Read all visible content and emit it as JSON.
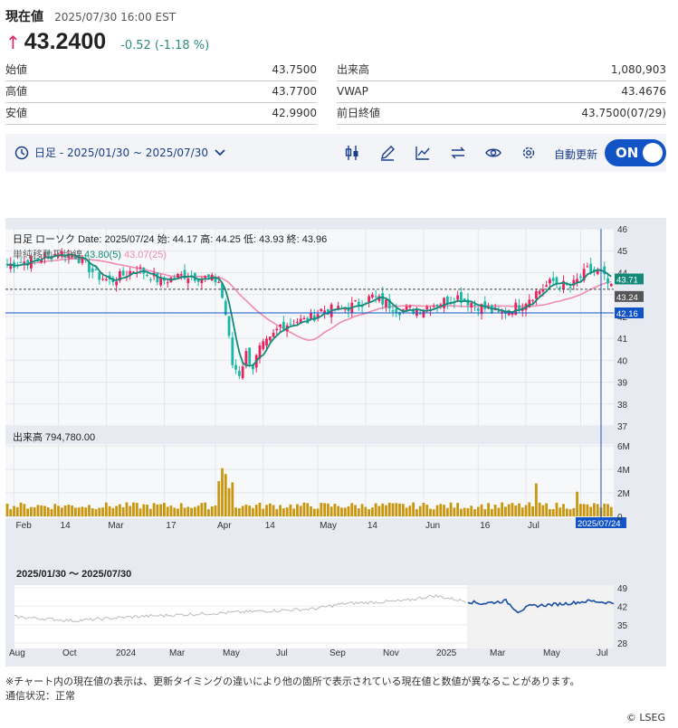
{
  "header": {
    "title": "現在値",
    "datetime": "2025/07/30 16:00 EST"
  },
  "quote": {
    "price": "43.2400",
    "change": "-0.52 (-1.18 %)"
  },
  "stats_left": [
    {
      "label": "始値",
      "value": "43.7500"
    },
    {
      "label": "高値",
      "value": "43.7700"
    },
    {
      "label": "安値",
      "value": "42.9900"
    }
  ],
  "stats_right": [
    {
      "label": "出来高",
      "value": "1,080,903"
    },
    {
      "label": "VWAP",
      "value": "43.4676"
    },
    {
      "label": "前日終値",
      "value": "43.7500(07/29)"
    }
  ],
  "toolbar": {
    "range": "日足 - 2025/01/30 ~ 2025/07/30",
    "auto_label": "自動更新",
    "toggle": "ON",
    "icons": [
      "candlestick-icon",
      "draw-pen-icon",
      "indicator-icon",
      "compare-arrows-icon",
      "eye-icon",
      "gear-icon"
    ]
  },
  "chart_info": {
    "line1": "日足 ローソク  Date: 2025/07/24 始: 44.17 高: 44.25 低: 43.93 終: 43.96",
    "ma_label": "単純移動平均線",
    "ma5": "43.80(5)",
    "ma25": "43.07(25)"
  },
  "volume_label": "出来高 794,780.00",
  "navigator_label": "2025/01/30 〜 2025/07/30",
  "colors": {
    "up": "#e8245e",
    "down": "#18b8a8",
    "ma5": "#138a78",
    "ma25": "#f08cb0",
    "volume": "#c9970f",
    "accent": "#1254c6"
  },
  "chart_data": [
    {
      "type": "candlestick",
      "title": "日足 ローソク",
      "y_ticks": [
        "46",
        "45",
        "44",
        "43",
        "42",
        "41",
        "40",
        "39",
        "38",
        "37"
      ],
      "ylim": [
        37,
        46
      ],
      "x_ticks": [
        "Feb",
        "14",
        "Mar",
        "17",
        "Apr",
        "14",
        "May",
        "14",
        "Jun",
        "16",
        "Jul",
        "16"
      ],
      "x_tick_days": [
        2,
        15,
        29,
        46,
        61,
        75,
        91,
        105,
        122,
        138,
        152,
        168
      ],
      "close_anchors": [
        [
          0,
          44.35
        ],
        [
          8,
          44.6
        ],
        [
          15,
          44.9
        ],
        [
          20,
          44.8
        ],
        [
          26,
          43.9
        ],
        [
          30,
          43.6
        ],
        [
          38,
          44.2
        ],
        [
          45,
          43.6
        ],
        [
          52,
          43.9
        ],
        [
          58,
          43.75
        ],
        [
          62,
          43.6
        ],
        [
          64,
          42.1
        ],
        [
          66,
          39.8
        ],
        [
          68,
          39.4
        ],
        [
          70,
          40.3
        ],
        [
          72,
          39.7
        ],
        [
          74,
          40.5
        ],
        [
          77,
          40.9
        ],
        [
          80,
          41.6
        ],
        [
          85,
          41.8
        ],
        [
          88,
          41.8
        ],
        [
          92,
          42.3
        ],
        [
          98,
          42.3
        ],
        [
          103,
          42.6
        ],
        [
          107,
          42.9
        ],
        [
          111,
          42.6
        ],
        [
          115,
          42.3
        ],
        [
          120,
          42.3
        ],
        [
          126,
          42.6
        ],
        [
          132,
          42.9
        ],
        [
          138,
          42.5
        ],
        [
          144,
          42.1
        ],
        [
          150,
          42.5
        ],
        [
          155,
          43.1
        ],
        [
          160,
          43.6
        ],
        [
          165,
          43.3
        ],
        [
          170,
          44.1
        ],
        [
          174,
          43.96
        ],
        [
          177,
          43.24
        ]
      ],
      "current_close": "43.24",
      "ma5_last": "43.71",
      "ma25_last": "43.24",
      "crosshair_price": "42.16",
      "crosshair_date": "2025/07/24"
    },
    {
      "type": "bar",
      "title": "出来高",
      "y_ticks": [
        "6M",
        "4M",
        "2M",
        "0"
      ],
      "ylim": [
        0,
        6000000
      ],
      "spikes": [
        [
          62,
          3000000
        ],
        [
          63,
          4100000
        ],
        [
          64,
          3600000
        ],
        [
          65,
          2400000
        ],
        [
          66,
          2900000
        ],
        [
          155,
          2800000
        ],
        [
          167,
          2100000
        ]
      ],
      "base_volume": 1000000,
      "last_volume": 794780
    },
    {
      "type": "area",
      "title": "2025/01/30 〜 2025/07/30",
      "y_ticks": [
        "49",
        "42",
        "35",
        "28"
      ],
      "ylim": [
        26,
        50
      ],
      "x_ticks": [
        "Aug",
        "Oct",
        "2024",
        "Mar",
        "May",
        "Jul",
        "Sep",
        "Nov",
        "2025",
        "Mar",
        "May",
        "Jul"
      ],
      "anchors": [
        [
          0,
          38
        ],
        [
          0.1,
          36.5
        ],
        [
          0.2,
          38
        ],
        [
          0.3,
          39
        ],
        [
          0.4,
          40
        ],
        [
          0.5,
          41
        ],
        [
          0.55,
          43
        ],
        [
          0.65,
          44
        ],
        [
          0.7,
          46
        ],
        [
          0.75,
          44
        ],
        [
          0.78,
          43
        ],
        [
          0.82,
          44
        ],
        [
          0.84,
          40
        ],
        [
          0.86,
          42
        ],
        [
          0.92,
          43
        ],
        [
          0.96,
          44
        ],
        [
          1,
          43.2
        ]
      ],
      "highlight_from": 0.755
    }
  ],
  "footnote": "※チャート内の現在値の表示は、更新タイミングの違いにより他の箇所で表示されている現在値と数値が異なることがあります。",
  "status": "通信状況：正常",
  "credit": "© LSEG"
}
